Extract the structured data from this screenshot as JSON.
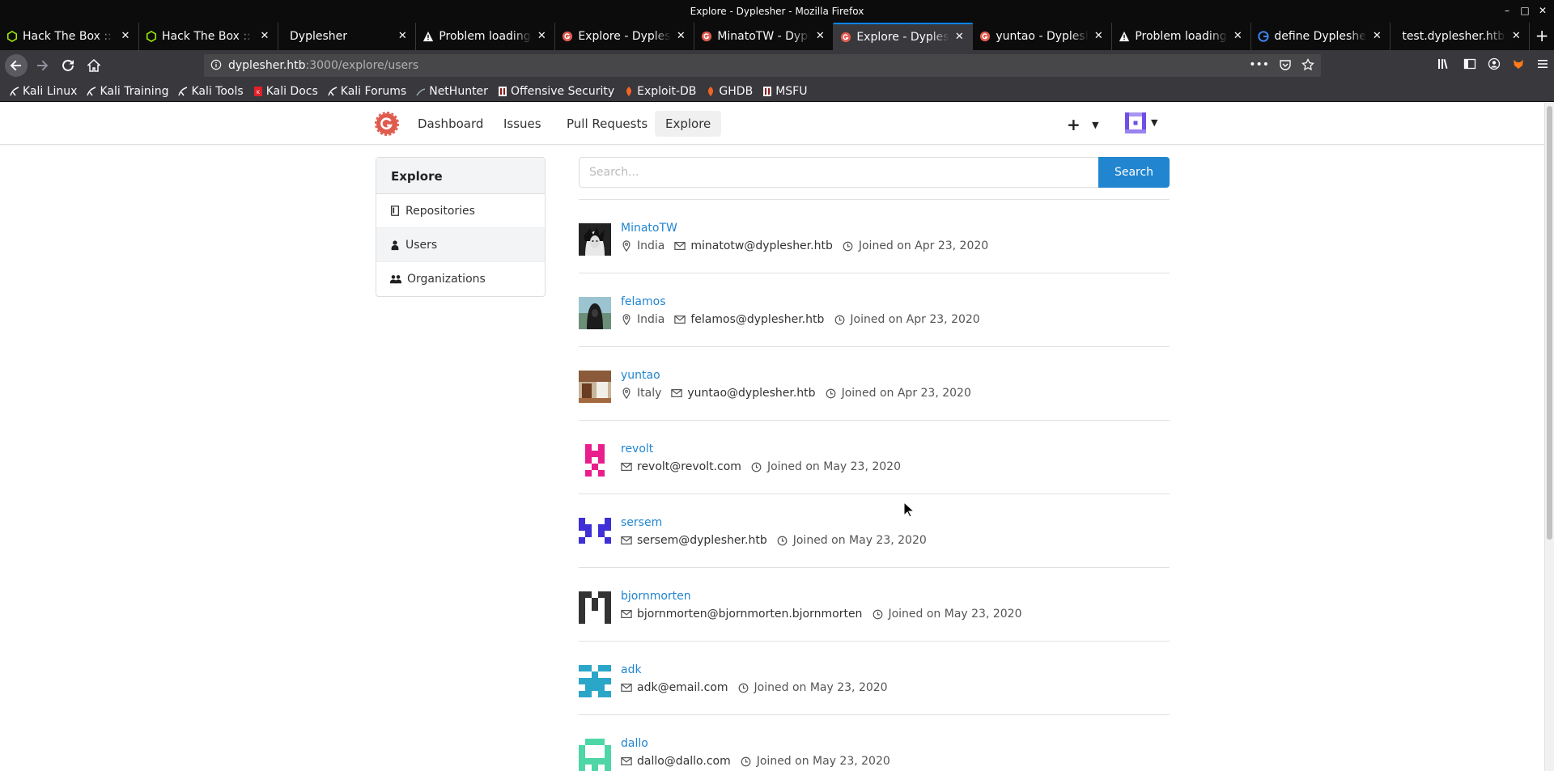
{
  "window": {
    "title": "Explore - Dyplesher - Mozilla Firefox"
  },
  "tabs": [
    {
      "title": "Hack The Box :: Hack The Box",
      "icon": "htb-icon",
      "active": false
    },
    {
      "title": "Hack The Box :: Dyplesher",
      "icon": "htb-icon",
      "active": false
    },
    {
      "title": "Dyplesher",
      "icon": "none",
      "active": false
    },
    {
      "title": "Problem loading page",
      "icon": "warning-icon",
      "active": false
    },
    {
      "title": "Explore - Dyplesher",
      "icon": "gitea-icon",
      "active": false
    },
    {
      "title": "MinatoTW - Dyplesher",
      "icon": "gitea-icon",
      "active": false
    },
    {
      "title": "Explore - Dyplesher",
      "icon": "gitea-icon",
      "active": true
    },
    {
      "title": "yuntao - Dyplesher",
      "icon": "gitea-icon",
      "active": false
    },
    {
      "title": "Problem loading page",
      "icon": "warning-icon",
      "active": false
    },
    {
      "title": "define Dyplesher - Google Search",
      "icon": "google-icon",
      "active": false
    },
    {
      "title": "test.dyplesher.htb/?",
      "icon": "none",
      "active": false
    }
  ],
  "urlbar": {
    "host": "dyplesher.htb",
    "rest": ":3000/explore/users"
  },
  "bookmarks": [
    {
      "label": "Kali Linux",
      "icon": "kali-icon"
    },
    {
      "label": "Kali Training",
      "icon": "kali-icon"
    },
    {
      "label": "Kali Tools",
      "icon": "kali-icon"
    },
    {
      "label": "Kali Docs",
      "icon": "kali-docs-icon"
    },
    {
      "label": "Kali Forums",
      "icon": "kali-icon"
    },
    {
      "label": "NetHunter",
      "icon": "nethunter-icon"
    },
    {
      "label": "Offensive Security",
      "icon": "offsec-icon"
    },
    {
      "label": "Exploit-DB",
      "icon": "exploitdb-icon"
    },
    {
      "label": "GHDB",
      "icon": "exploitdb-icon"
    },
    {
      "label": "MSFU",
      "icon": "offsec-icon"
    }
  ],
  "nav": {
    "items": [
      "Dashboard",
      "Issues",
      "Pull Requests",
      "Explore"
    ],
    "active": "Explore"
  },
  "sidebar": {
    "header": "Explore",
    "items": [
      {
        "label": "Repositories",
        "icon": "book-icon",
        "active": false
      },
      {
        "label": "Users",
        "icon": "person-icon",
        "active": true
      },
      {
        "label": "Organizations",
        "icon": "organization-icon",
        "active": false
      }
    ]
  },
  "search": {
    "placeholder": "Search...",
    "value": "",
    "button": "Search"
  },
  "users": [
    {
      "name": "MinatoTW",
      "location": "India",
      "email": "minatotw@dyplesher.htb",
      "joined": "Joined on Apr 23, 2020",
      "avatar": "photo-dark"
    },
    {
      "name": "felamos",
      "location": "India",
      "email": "felamos@dyplesher.htb",
      "joined": "Joined on Apr 23, 2020",
      "avatar": "photo-hooded"
    },
    {
      "name": "yuntao",
      "location": "Italy",
      "email": "yuntao@dyplesher.htb",
      "joined": "Joined on Apr 23, 2020",
      "avatar": "photo-room"
    },
    {
      "name": "revolt",
      "location": "",
      "email": "revolt@revolt.com",
      "joined": "Joined on May 23, 2020",
      "avatar": "identicon",
      "color": "#e91e8c"
    },
    {
      "name": "sersem",
      "location": "",
      "email": "sersem@dyplesher.htb",
      "joined": "Joined on May 23, 2020",
      "avatar": "identicon",
      "color": "#3f2fd6"
    },
    {
      "name": "bjornmorten",
      "location": "",
      "email": "bjornmorten@bjornmorten.bjornmorten",
      "joined": "Joined on May 23, 2020",
      "avatar": "identicon",
      "color": "#333333"
    },
    {
      "name": "adk",
      "location": "",
      "email": "adk@email.com",
      "joined": "Joined on May 23, 2020",
      "avatar": "identicon",
      "color": "#2aa6c8"
    },
    {
      "name": "dallo",
      "location": "",
      "email": "dallo@dallo.com",
      "joined": "Joined on May 23, 2020",
      "avatar": "identicon",
      "color": "#4fd6a6"
    }
  ],
  "colors": {
    "accent": "#2185d0",
    "gitea": "#e05a4e"
  }
}
